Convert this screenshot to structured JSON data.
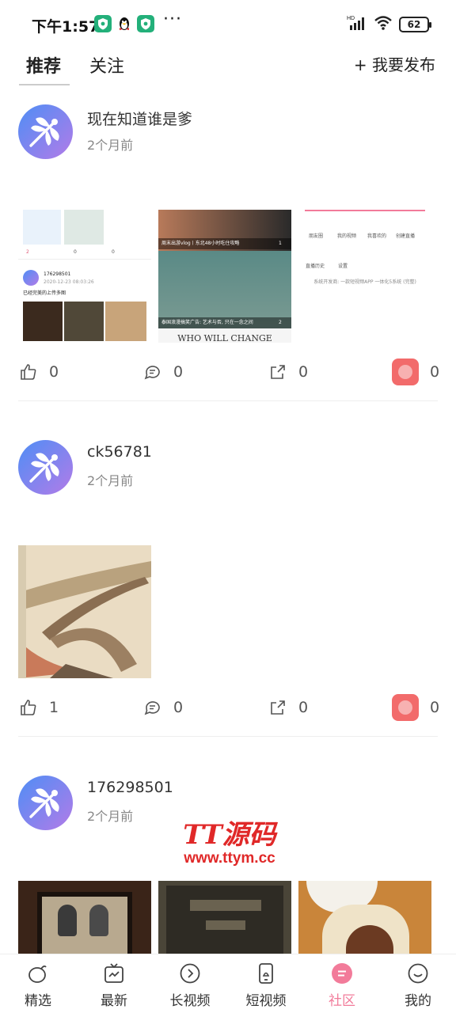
{
  "status_bar": {
    "time": "下午1:57",
    "dots": "···",
    "network": "HD",
    "battery": "62"
  },
  "top_tabs": {
    "recommend": "推荐",
    "follow": "关注",
    "publish": "+ 我要发布"
  },
  "posts": [
    {
      "author": "现在知道谁是爹",
      "time": "2个月前",
      "likes": "0",
      "comments": "0",
      "shares": "0",
      "gifts": "0",
      "thumbs": {
        "t1": {
          "like_count": "2",
          "comment_count": "0",
          "share_count": "0",
          "user": "176298501",
          "date": "2020-12-23 08:03:26",
          "caption": "已经完美的上传多图"
        },
        "t2": {
          "caption_top": "周末出游vlog丨东北48小时吃住攻略",
          "likes_top": "1",
          "caption_bottom": "泰国浪漫搞笑广告: 艺术与否, 只在一念之间",
          "likes_bottom": "2",
          "footer_text": "WHO WILL CHANGE"
        },
        "t3": {
          "menu": [
            "朋友圈",
            "我的视频",
            "我喜欢的",
            "创建直播",
            "直播历史",
            "设置"
          ],
          "footer": "系统开发商: 一款短视频APP 一体化5系统 (完整)"
        }
      }
    },
    {
      "author": "ck56781",
      "time": "2个月前",
      "likes": "1",
      "comments": "0",
      "shares": "0",
      "gifts": "0"
    },
    {
      "author": "176298501",
      "time": "2个月前"
    }
  ],
  "watermark": {
    "title": "TT源码",
    "url": "www.ttym.cc"
  },
  "bottom_nav": [
    {
      "label": "精选",
      "icon": "egg-icon"
    },
    {
      "label": "最新",
      "icon": "tv-icon"
    },
    {
      "label": "长视频",
      "icon": "play-circle-icon"
    },
    {
      "label": "短视频",
      "icon": "phone-icon"
    },
    {
      "label": "社区",
      "icon": "community-icon"
    },
    {
      "label": "我的",
      "icon": "smile-icon"
    }
  ],
  "colors": {
    "accent": "#f27b9a",
    "gift": "#f26b6b",
    "watermark": "#e02828"
  }
}
